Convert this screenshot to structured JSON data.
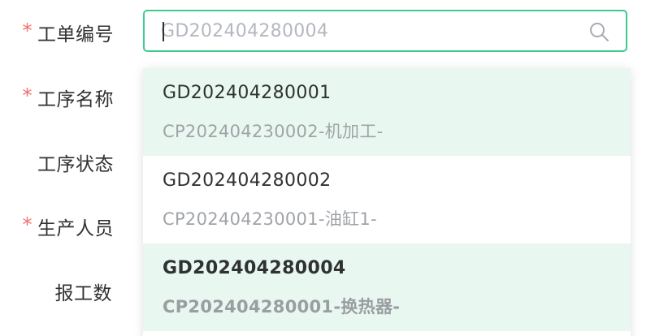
{
  "form": {
    "required_mark": "*",
    "fields": [
      {
        "label": "工单编号",
        "required": true
      },
      {
        "label": "工序名称",
        "required": true
      },
      {
        "label": "工序状态",
        "required": false
      },
      {
        "label": "生产人员",
        "required": true
      },
      {
        "label": "报工数",
        "required": false
      }
    ]
  },
  "work_order_input": {
    "placeholder": "GD202404280004",
    "value": "",
    "focus_color": "#3ecb8f",
    "icon": "search-icon"
  },
  "dropdown": {
    "options": [
      {
        "code": "GD202404280001",
        "detail": "CP202404230002-机加工-",
        "highlighted": true,
        "selected": false
      },
      {
        "code": "GD202404280002",
        "detail": "CP202404230001-油缸1-",
        "highlighted": false,
        "selected": false
      },
      {
        "code": "GD202404280004",
        "detail": "CP202404280001-换热器-",
        "highlighted": true,
        "selected": true
      }
    ],
    "highlight_color": "#e8f8f0"
  }
}
